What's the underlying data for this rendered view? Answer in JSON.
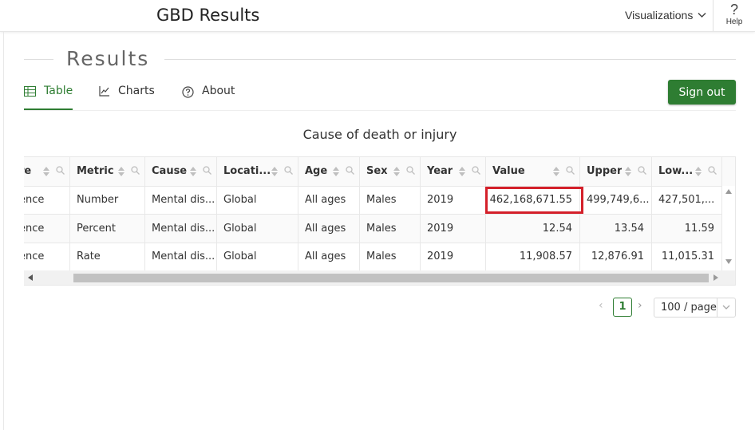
{
  "header": {
    "title": "GBD Results",
    "visualizations_label": "Visualizations",
    "help_icon_glyph": "?",
    "help_label": "Help"
  },
  "section": {
    "heading": "Results"
  },
  "tabs": [
    {
      "label": "Table",
      "icon": "table-icon",
      "active": true
    },
    {
      "label": "Charts",
      "icon": "line-chart-icon",
      "active": false
    },
    {
      "label": "About",
      "icon": "question-circle-icon",
      "active": false
    }
  ],
  "sign_out_label": "Sign out",
  "table": {
    "title": "Cause of death or injury",
    "columns": [
      "re",
      "Metric",
      "Cause",
      "Locati...",
      "Age",
      "Sex",
      "Year",
      "Value",
      "Upper",
      "Low..."
    ],
    "rows": [
      [
        "ence",
        "Number",
        "Mental dis...",
        "Global",
        "All ages",
        "Males",
        "2019",
        "462,168,671.55",
        "499,749,6...",
        "427,501,..."
      ],
      [
        "ence",
        "Percent",
        "Mental dis...",
        "Global",
        "All ages",
        "Males",
        "2019",
        "12.54",
        "13.54",
        "11.59"
      ],
      [
        "ence",
        "Rate",
        "Mental dis...",
        "Global",
        "All ages",
        "Males",
        "2019",
        "11,908.57",
        "12,876.91",
        "11,015.31"
      ]
    ],
    "highlighted_cell": {
      "row": 0,
      "column": "Value"
    }
  },
  "pagination": {
    "current_page": "1",
    "page_size": "100 / page"
  },
  "colors": {
    "accent": "#2e7d32",
    "highlight": "#d4202a"
  }
}
